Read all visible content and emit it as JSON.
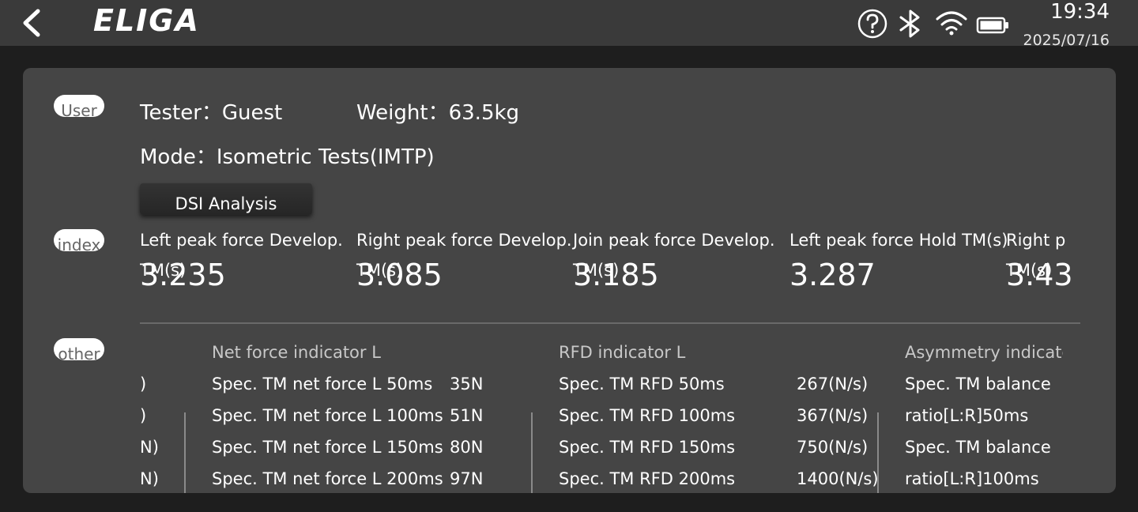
{
  "header": {
    "logo": "ELIGA",
    "time": "19:34",
    "date": "2025/07/16",
    "icons": [
      "back-chevron-icon",
      "help-icon",
      "bluetooth-icon",
      "wifi-icon",
      "battery-icon"
    ]
  },
  "user": {
    "pill": "User",
    "tester_label": "Tester：",
    "tester_value": "Guest",
    "weight_label": "Weight：",
    "weight_value": "63.5kg",
    "mode_label": "Mode：",
    "mode_value": "Isometric Tests(IMTP)",
    "dsi_button": "DSI Analysis"
  },
  "index": {
    "pill": "index",
    "items": [
      {
        "label": "Left peak force Develop.",
        "label2": "TM(s)",
        "value": "3.235"
      },
      {
        "label": "Right peak force Develop.",
        "label2": "TM(s)",
        "value": "3.085"
      },
      {
        "label": "Join peak force Develop.",
        "label2": "TM(s)",
        "value": "3.185"
      },
      {
        "label": "Left peak force Hold TM(s)",
        "label2": "",
        "value": "3.287"
      },
      {
        "label": "Right p",
        "label2": "TM(s)",
        "value": "3.43"
      }
    ]
  },
  "other": {
    "pill": "other",
    "left_clip": [
      ")",
      ")",
      "N)",
      "N)"
    ],
    "groups": [
      {
        "title": "Net force indicator L",
        "rows": [
          {
            "name": "Spec. TM net force L 50ms",
            "value": "35N"
          },
          {
            "name": "Spec. TM net force L 100ms",
            "value": "51N"
          },
          {
            "name": "Spec. TM net force L 150ms",
            "value": "80N"
          },
          {
            "name": "Spec. TM net force L 200ms",
            "value": "97N"
          }
        ]
      },
      {
        "title": "RFD indicator L",
        "rows": [
          {
            "name": "Spec. TM RFD 50ms",
            "value": "267(N/s)"
          },
          {
            "name": "Spec. TM RFD 100ms",
            "value": "367(N/s)"
          },
          {
            "name": "Spec. TM RFD 150ms",
            "value": "750(N/s)"
          },
          {
            "name": "Spec. TM RFD 200ms",
            "value": "1400(N/s)"
          }
        ]
      },
      {
        "title": "Asymmetry indicatc",
        "rows": [
          {
            "name": "Spec. TM balance",
            "value": ""
          },
          {
            "name": "ratio[L:R]50ms",
            "value": ""
          },
          {
            "name": "Spec. TM balance",
            "value": ""
          },
          {
            "name": "ratio[L:R]100ms",
            "value": ""
          }
        ]
      }
    ]
  }
}
